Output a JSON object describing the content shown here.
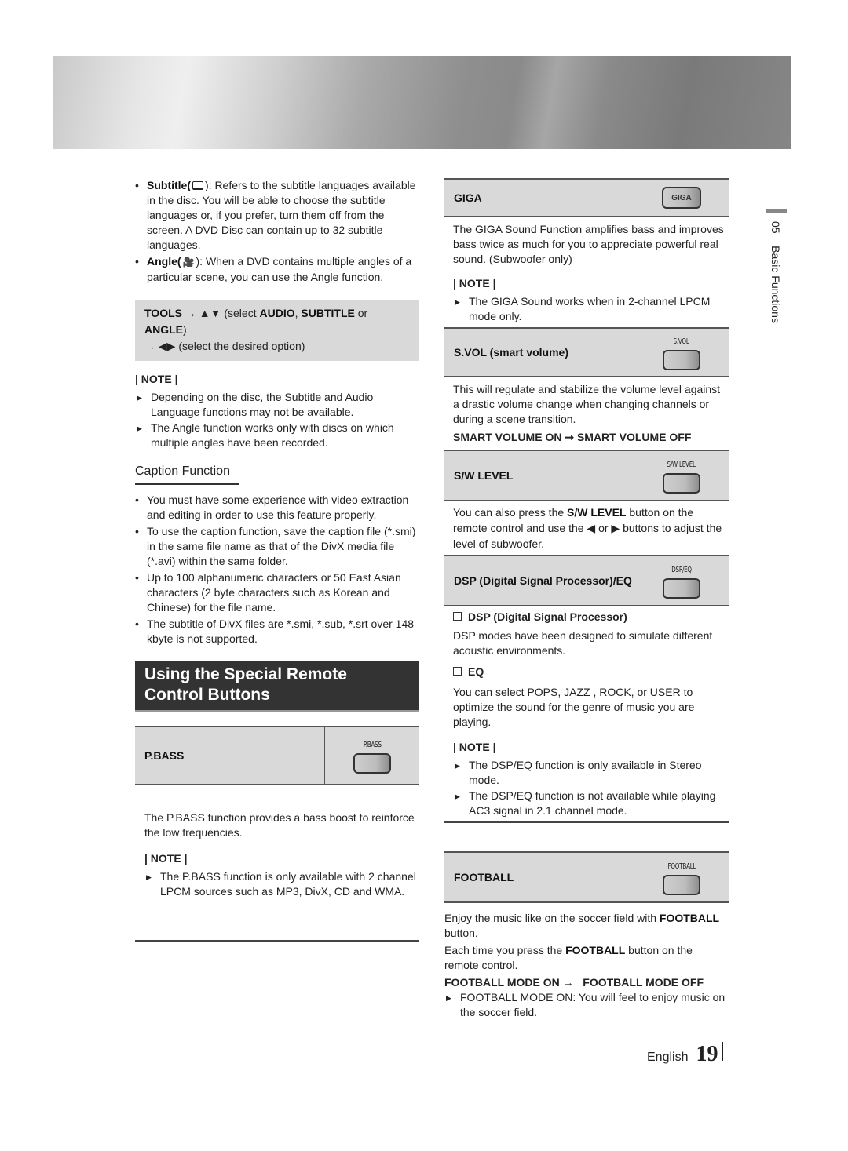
{
  "header": {
    "banner": "decorative-metallic-banner"
  },
  "left": {
    "bullets": [
      {
        "term": "Subtitle(",
        "icon": "subtitle-icon",
        "rest": "): Refers to the subtitle languages available in the disc. You will be able to choose the subtitle languages or, if you prefer, turn them off from the screen. A DVD Disc can contain up to 32 subtitle languages."
      },
      {
        "term": "Angle(",
        "icon": "angle-icon",
        "rest": "): When a DVD contains multiple angles of a particular scene, you can use the Angle function."
      }
    ],
    "tools_box": {
      "t1": "TOOLS",
      "a1": " → ▲▼ (select ",
      "t2": "AUDIO",
      "c1": ", ",
      "t3": "SUBTITLE",
      "c2": " or ",
      "t4": "ANGLE",
      "c3": ")",
      "line2": "→ ◀▶ (select the desired option)"
    },
    "note1": {
      "heading": "| NOTE |",
      "items": [
        "Depending on the disc, the Subtitle and Audio Language functions may not be available.",
        "The Angle function works only with discs on which multiple angles have been recorded."
      ]
    },
    "caption": {
      "heading": "Caption Function",
      "items": [
        "You must have some experience with video extraction and editing in order to use this feature properly.",
        "To use the caption function, save the caption file (*.smi) in the same file name as that of the DivX media file (*.avi) within the same folder.",
        "Up to 100 alphanumeric characters or 50 East Asian characters (2 byte characters such as Korean and Chinese) for the file name.",
        "The subtitle of DivX files are *.smi, *.sub, *.srt over 148 kbyte is not supported."
      ]
    },
    "section_title": "Using the Special Remote Control Buttons",
    "pbass": {
      "label": "P.BASS",
      "button_caption": "P.BASS",
      "desc": "The P.BASS function provides a bass boost to reinforce the low frequencies.",
      "note_heading": "| NOTE |",
      "notes": [
        "The P.BASS function is only available with 2 channel LPCM sources such as MP3, DivX, CD and WMA."
      ]
    }
  },
  "right": {
    "giga": {
      "label": "GIGA",
      "button_text": "GIGA",
      "desc": "The GIGA Sound Function amplifies bass and improves bass twice as much for you to appreciate powerful real sound. (Subwoofer only)",
      "note_heading": "| NOTE |",
      "notes": [
        "The GIGA Sound works when in 2-channel LPCM mode only."
      ]
    },
    "svol": {
      "label": "S.VOL (smart volume)",
      "button_caption": "S.VOL",
      "desc": "This will regulate and stabilize the volume level against a drastic volume change when changing channels or during a scene transition.",
      "toggle": "SMART VOLUME ON ➞ SMART VOLUME OFF"
    },
    "swlevel": {
      "label": "S/W LEVEL",
      "button_caption": "S/W LEVEL",
      "desc_a": "You can also press the ",
      "desc_b": "S/W LEVEL",
      "desc_c": " button on the remote control and use the ◀ or ▶ buttons to adjust the level of subwoofer."
    },
    "dspeq": {
      "label": "DSP (Digital Signal Processor)/EQ",
      "button_caption": "DSP/EQ",
      "dsp_heading": "DSP (Digital Signal Processor)",
      "dsp_desc": "DSP modes have been designed to simulate different acoustic environments.",
      "eq_heading": "EQ",
      "eq_desc": "You can select POPS, JAZZ , ROCK, or USER to optimize the sound for the genre of music you are playing.",
      "note_heading": "| NOTE |",
      "notes": [
        "The DSP/EQ function is only available in Stereo mode.",
        "The DSP/EQ function is not available while playing AC3 signal in 2.1 channel mode."
      ]
    },
    "football": {
      "label": "FOOTBALL",
      "button_caption": "FOOTBALL",
      "desc1_a": "Enjoy the music like on the soccer field with ",
      "desc1_b": "FOOTBALL",
      "desc1_c": " button.",
      "desc2_a": "Each time you press the ",
      "desc2_b": "FOOTBALL",
      "desc2_c": " button on the remote control.",
      "toggle": "FOOTBALL MODE ON →   FOOTBALL MODE OFF",
      "notes": [
        "FOOTBALL MODE ON: You will feel to enjoy music on the soccer field."
      ]
    }
  },
  "side_tab": {
    "chapter": "05",
    "title": "Basic Functions"
  },
  "footer": {
    "language": "English",
    "page_number": "19"
  }
}
